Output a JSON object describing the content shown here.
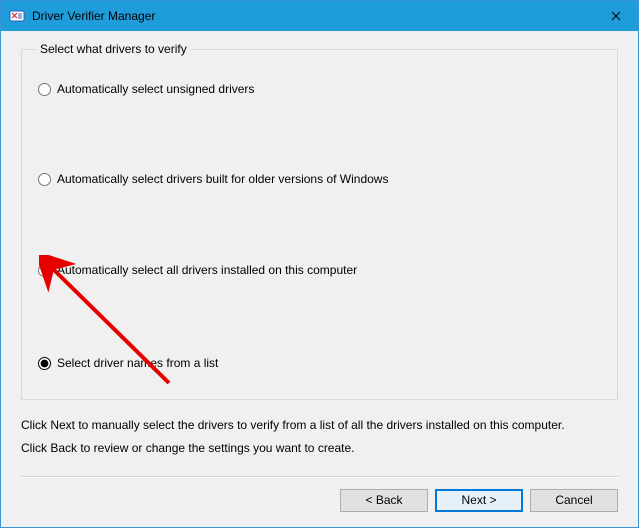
{
  "window": {
    "title": "Driver Verifier Manager"
  },
  "group": {
    "legend": "Select what drivers to verify",
    "options": [
      {
        "label": "Automatically select unsigned drivers"
      },
      {
        "label": "Automatically select drivers built for older versions of Windows"
      },
      {
        "label": "Automatically select all drivers installed on this computer"
      },
      {
        "label": "Select driver names from a list"
      }
    ],
    "selected_index": 3
  },
  "instructions": {
    "line1": "Click Next to manually select the drivers to verify from a list of all the drivers installed on this computer.",
    "line2": "Click Back to review or change the settings you want to create."
  },
  "buttons": {
    "back": "< Back",
    "next": "Next >",
    "cancel": "Cancel"
  }
}
